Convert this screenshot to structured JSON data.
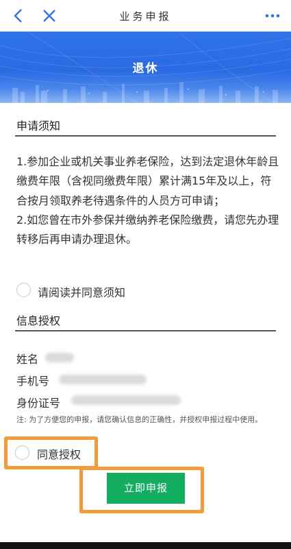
{
  "navbar": {
    "title": "业务申报",
    "back_icon": "chevron-left-icon",
    "close_icon": "close-icon",
    "more_icon": "more-dots-icon",
    "accent_color": "#2f73e8"
  },
  "banner": {
    "title": "退休"
  },
  "notice": {
    "heading": "申请须知",
    "text": "1.参加企业或机关事业养老保险，达到法定退休年龄且缴费年限（含视同缴费年限）累计满15年及以上，符合按月领取养老待遇条件的人员方可申请；\n2.如您曾在市外参保并缴纳养老保险缴费，请您先办理转移后再申请办理退休。",
    "agree_label": "请阅读并同意须知"
  },
  "info": {
    "heading": "信息授权",
    "name_label": "姓名",
    "phone_label": "手机号",
    "id_label": "身份证号",
    "note": "注:  为了方便您的申报，请您确认信息的正确性，并授权申报过程中使用。",
    "authorize_label": "同意授权"
  },
  "submit": {
    "label": "立即申报",
    "color": "#13ad5f"
  },
  "highlight_color": "#f39a3b"
}
